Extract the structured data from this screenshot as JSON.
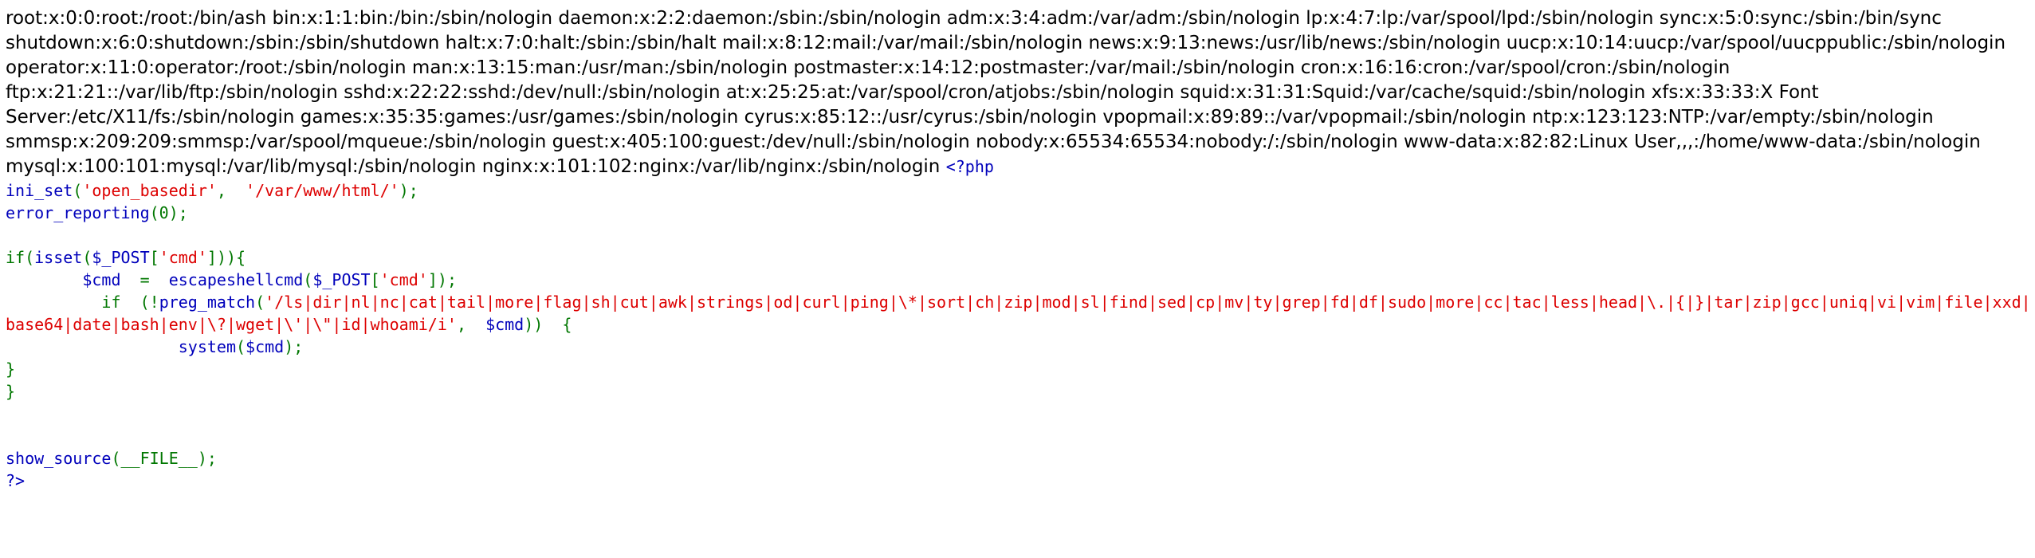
{
  "passwd_output": "root:x:0:0:root:/root:/bin/ash bin:x:1:1:bin:/bin:/sbin/nologin daemon:x:2:2:daemon:/sbin:/sbin/nologin adm:x:3:4:adm:/var/adm:/sbin/nologin lp:x:4:7:lp:/var/spool/lpd:/sbin/nologin sync:x:5:0:sync:/sbin:/bin/sync shutdown:x:6:0:shutdown:/sbin:/sbin/shutdown halt:x:7:0:halt:/sbin:/sbin/halt mail:x:8:12:mail:/var/mail:/sbin/nologin news:x:9:13:news:/usr/lib/news:/sbin/nologin uucp:x:10:14:uucp:/var/spool/uucppublic:/sbin/nologin operator:x:11:0:operator:/root:/sbin/nologin man:x:13:15:man:/usr/man:/sbin/nologin postmaster:x:14:12:postmaster:/var/mail:/sbin/nologin cron:x:16:16:cron:/var/spool/cron:/sbin/nologin ftp:x:21:21::/var/lib/ftp:/sbin/nologin sshd:x:22:22:sshd:/dev/null:/sbin/nologin at:x:25:25:at:/var/spool/cron/atjobs:/sbin/nologin squid:x:31:31:Squid:/var/cache/squid:/sbin/nologin xfs:x:33:33:X Font Server:/etc/X11/fs:/sbin/nologin games:x:35:35:games:/usr/games:/sbin/nologin cyrus:x:85:12::/usr/cyrus:/sbin/nologin vpopmail:x:89:89::/var/vpopmail:/sbin/nologin ntp:x:123:123:NTP:/var/empty:/sbin/nologin smmsp:x:209:209:smmsp:/var/spool/mqueue:/sbin/nologin guest:x:405:100:guest:/dev/null:/sbin/nologin nobody:x:65534:65534:nobody:/:/sbin/nologin www-data:x:82:82:Linux User,,,:/home/www-data:/sbin/nologin mysql:x:100:101:mysql:/var/lib/mysql:/sbin/nologin nginx:x:101:102:nginx:/var/lib/nginx:/sbin/nologin",
  "source": {
    "php_open": "<?php",
    "line_ini_fn": "ini_set",
    "line_ini_open": "(",
    "line_ini_arg1": "'open_basedir'",
    "line_ini_sep": ",  ",
    "line_ini_arg2": "'/var/www/html/'",
    "line_ini_close": ");",
    "line_err_fn": "error_reporting",
    "line_err_args": "(0);",
    "if_kw": "if(",
    "if_fn": "isset",
    "if_args_open": "(",
    "if_var": "$_POST",
    "if_bracket_open": "[",
    "if_key": "'cmd'",
    "if_bracket_close": "])){",
    "cmd_indent": "        ",
    "cmd_var": "$cmd",
    "cmd_eq": "  =  ",
    "cmd_fn": "escapeshellcmd",
    "cmd_paren": "(",
    "cmd_post": "$_POST",
    "cmd_br_open": "[",
    "cmd_key": "'cmd'",
    "cmd_br_close": "]);",
    "pm_indent": "          ",
    "pm_if": "if  (",
    "pm_not": "!",
    "pm_fn": "preg_match",
    "pm_paren": "(",
    "pm_regex_part1": "'/ls|dir|nl|nc|cat|tail|more|flag|sh|cut|awk|strings|od|curl|ping|\\*|sort|ch|zip|mod|sl|find|sed|cp|mv|ty|grep|fd|df|sudo|more|cc|tac|less|head|\\.|{|}|tar|zip|gcc|uniq|vi|vim|file|xxd|",
    "pm_regex_part2": "base64|date|bash|env|\\?|wget|\\'|\\\"|id|whoami/i'",
    "pm_comma": ",  ",
    "pm_var": "$cmd",
    "pm_close": "))  {",
    "sys_indent": "                  ",
    "sys_fn": "system",
    "sys_paren": "(",
    "sys_var": "$cmd",
    "sys_close": ");",
    "close_brace_1": "}",
    "close_brace_2": "}",
    "show_fn": "show_source",
    "show_args": "(__FILE__);",
    "php_close": "?>"
  }
}
